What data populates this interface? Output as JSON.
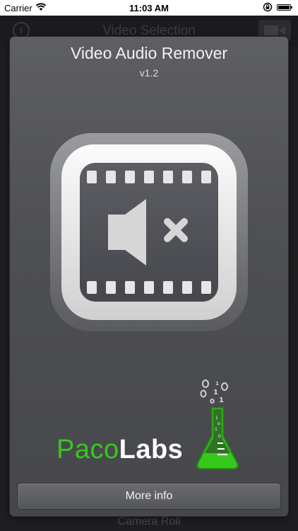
{
  "status_bar": {
    "carrier": "Carrier",
    "time": "11:03 AM"
  },
  "background": {
    "nav_title": "Video Selection",
    "footer_label": "Camera Roll"
  },
  "popup": {
    "title": "Video Audio Remover",
    "version": "v1.2",
    "logo": {
      "paco": "Paco",
      "labs": "Labs"
    },
    "more_info_label": "More info"
  },
  "icons": [
    "wifi-icon",
    "lock-rotation-icon",
    "battery-icon",
    "info-icon",
    "camera-icon",
    "film-muted-icon",
    "flask-icon"
  ],
  "colors": {
    "brand_green": "#36c91b",
    "panel": "#55565a",
    "icon_dark": "#4f5157",
    "icon_light": "#e8e8e8"
  }
}
